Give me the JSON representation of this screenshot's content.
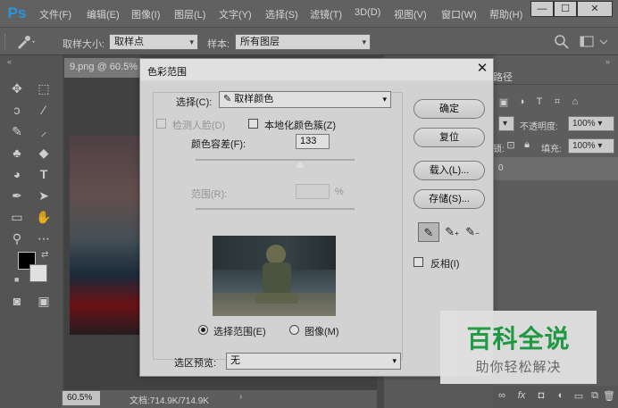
{
  "app": {
    "logo": "Ps",
    "menus": [
      "文件(F)",
      "编辑(E)",
      "图像(I)",
      "图层(L)",
      "文字(Y)",
      "选择(S)",
      "滤镜(T)",
      "3D(D)",
      "视图(V)",
      "窗口(W)",
      "帮助(H)"
    ]
  },
  "window_controls": {
    "minimize": "—",
    "maximize": "☐",
    "close": "✕"
  },
  "options": {
    "sample_size_label": "取样大小:",
    "sample_size_value": "取样点",
    "sample_label": "样本:",
    "sample_value": "所有图层"
  },
  "document": {
    "tab_label": "9.png @ 60.5%",
    "zoom": "60.5%",
    "info": "文档:714.9K/714.9K"
  },
  "panel": {
    "tab_label": "路径",
    "opacity_label": "不透明度:",
    "opacity_value": "100%",
    "fill_label": "填充:",
    "fill_value": "100%",
    "layer_text": "0",
    "lock_label": "锁:"
  },
  "dialog": {
    "title": "色彩范围",
    "select_label": "选择(C):",
    "select_value": "取样颜色",
    "detect_faces": "检测人脸(D)",
    "localized_clusters": "本地化颜色簇(Z)",
    "fuzziness_label": "颜色容差(F):",
    "fuzziness_value": "133",
    "range_label": "范围(R):",
    "range_unit": "%",
    "range_value": "",
    "buttons": {
      "ok": "确定",
      "reset": "复位",
      "load": "载入(L)...",
      "save": "存储(S)..."
    },
    "invert": "反相(I)",
    "view_selection": "选择范围(E)",
    "view_image": "图像(M)",
    "preview_label": "选区预览:",
    "preview_value": "无"
  },
  "watermark": {
    "main": "百科全说",
    "sub": "助你轻松解决"
  },
  "colors": {
    "ps_blue": "#31a8ff",
    "watermark_green": "#22b04a"
  }
}
